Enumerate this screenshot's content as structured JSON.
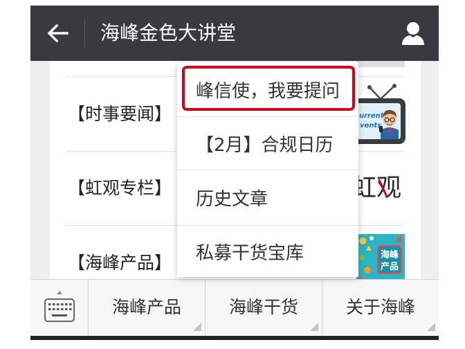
{
  "header": {
    "title": "海峰金色大讲堂",
    "back_icon": "back-arrow-icon",
    "profile_icon": "person-icon"
  },
  "articles": [
    {
      "title": "【时事要闻】",
      "thumbnail": {
        "line1": "urrent",
        "line2": "vents"
      }
    },
    {
      "title": "【虹观专栏】",
      "thumbnail": {
        "text": "虹观"
      }
    },
    {
      "title": "【海峰产品】",
      "thumbnail": {
        "line1": "海峰",
        "line2": "产品"
      }
    }
  ],
  "popup_menu": {
    "items": [
      {
        "label": "峰信使，我要提问",
        "highlighted": true
      },
      {
        "label": "【2月】合规日历",
        "highlighted": false
      },
      {
        "label": "历史文章",
        "highlighted": false
      },
      {
        "label": "私募干货宝库",
        "highlighted": false
      }
    ]
  },
  "bottom_menu": {
    "keyboard_icon": "keyboard-icon",
    "items": [
      {
        "label": "海峰产品",
        "submenu_icon": "corner-triangle-icon"
      },
      {
        "label": "海峰干货",
        "submenu_icon": "corner-triangle-icon"
      },
      {
        "label": "关于海峰",
        "submenu_icon": "corner-triangle-icon"
      }
    ]
  },
  "colors": {
    "header_background": "#393a3f",
    "header_text": "#ffffff",
    "highlight_border": "#d9001b",
    "page_background": "#efeff0",
    "menu_bar_background": "#f7f7f8"
  }
}
